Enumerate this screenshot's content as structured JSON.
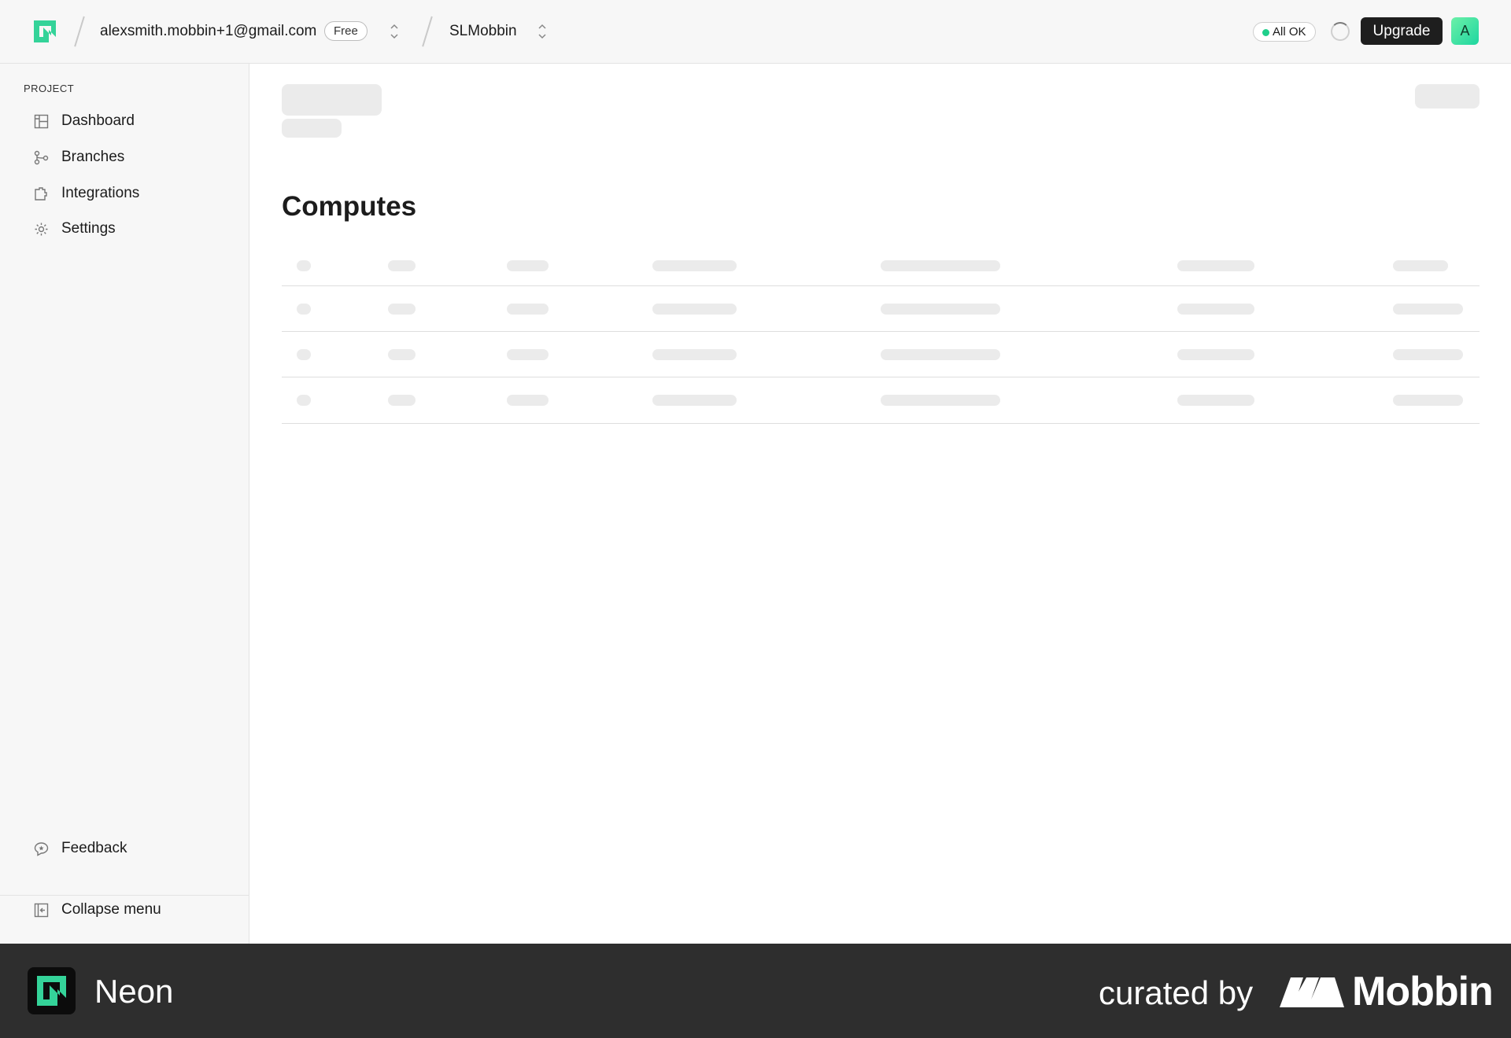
{
  "header": {
    "account_email": "alexsmith.mobbin+1@gmail.com",
    "plan_badge": "Free",
    "project_name": "SLMobbin",
    "status_label": "All OK",
    "upgrade_label": "Upgrade",
    "avatar_initial": "A"
  },
  "sidebar": {
    "section_label": "PROJECT",
    "items": [
      {
        "label": "Dashboard",
        "icon": "dashboard-icon"
      },
      {
        "label": "Branches",
        "icon": "branches-icon"
      },
      {
        "label": "Integrations",
        "icon": "integrations-icon"
      },
      {
        "label": "Settings",
        "icon": "gear-icon"
      }
    ],
    "feedback_label": "Feedback",
    "collapse_label": "Collapse menu"
  },
  "main": {
    "title": "Computes"
  },
  "footer": {
    "app_name": "Neon",
    "curated_label": "curated by",
    "brand_name": "Mobbin"
  },
  "colors": {
    "accent_green": "#1fcf8b",
    "upgrade_bg": "#1e1e1e",
    "footer_bg": "#2e2e2e"
  }
}
